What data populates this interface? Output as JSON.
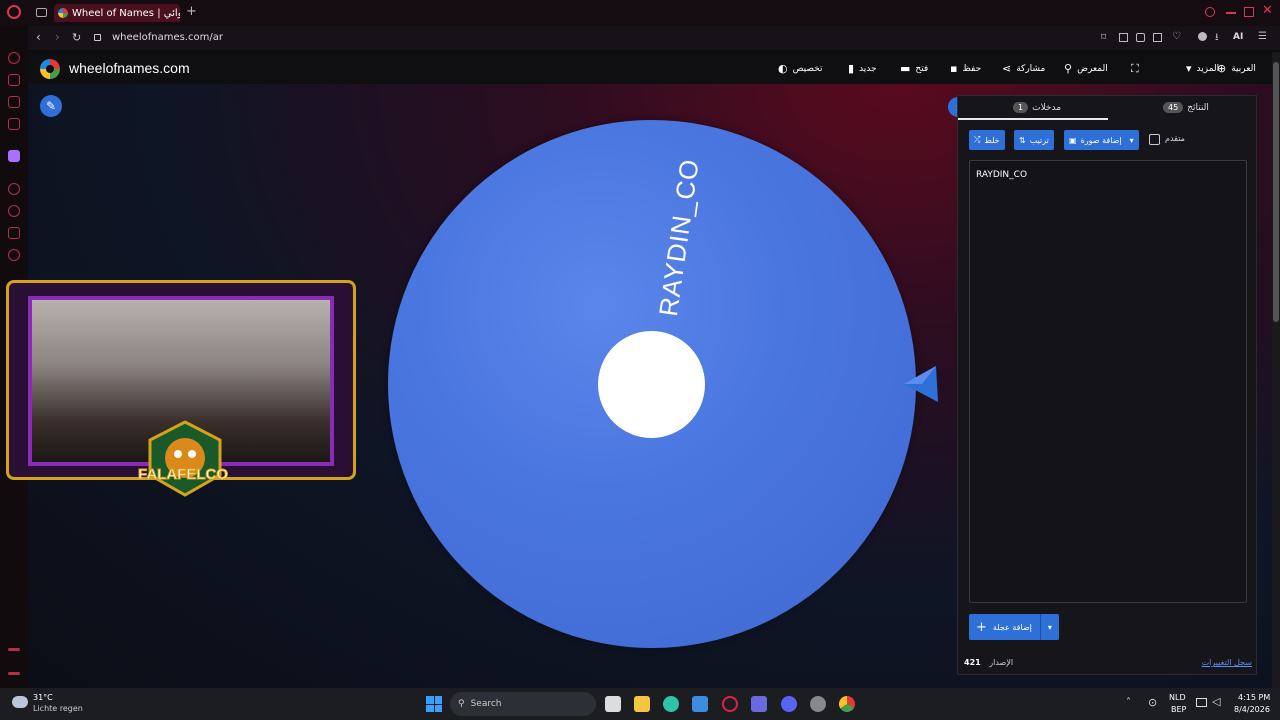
{
  "browser": {
    "tab_title": "Wheel of Names | العشوائي",
    "new_tab": "+",
    "url": "wheelofnames.com/ar",
    "ai_label": "AI"
  },
  "site": {
    "name": "wheelofnames.com",
    "nav": {
      "language": "العربية",
      "more": "المزيد",
      "gallery": "المعرض",
      "share": "مشاركة",
      "save": "حفظ",
      "open": "فتح",
      "new": "جديد",
      "customize": "تخصيص"
    }
  },
  "wheel": {
    "segments": [
      "RAYDIN_CO"
    ],
    "color": "#4a76e0"
  },
  "overlay": {
    "brand": "FALAFELCO"
  },
  "panel": {
    "tab_entries_label": "مدخلات",
    "tab_entries_count": "1",
    "tab_results_label": "النتائج",
    "tab_results_count": "45",
    "btn_shuffle": "خلط",
    "btn_sort": "ترتيب",
    "btn_add_image": "إضافة صورة",
    "advanced_label": "متقدم",
    "entries": [
      "RAYDIN_CO"
    ],
    "add_wheel": "إضافة عجلة",
    "version_label": "الإصدار",
    "version_number": "421",
    "changelog": "سجل التغييرات"
  },
  "taskbar": {
    "weather_temp": "31°C",
    "weather_desc": "Lichte regen",
    "search_placeholder": "Search",
    "lang_top": "NLD",
    "lang_bottom": "BEP",
    "time": "4:15 PM",
    "date": "8/4/2026"
  }
}
